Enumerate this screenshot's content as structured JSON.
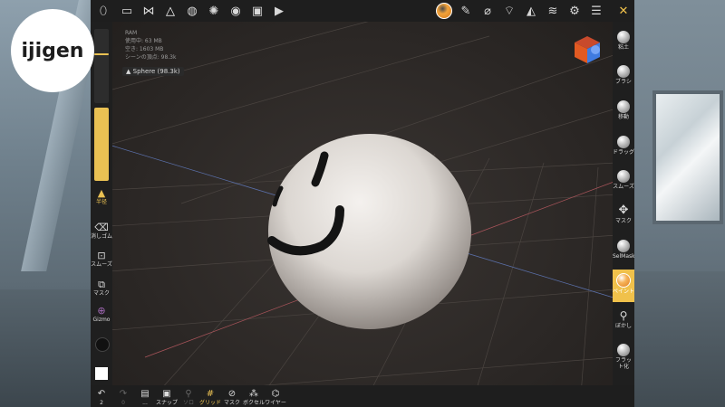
{
  "logo": {
    "text": "ijigen"
  },
  "stats": {
    "ram": "RAM",
    "used": "使用中: 63 MB",
    "free": "空き: 1603 MB",
    "scene": "シーンの頂点: 98.3k"
  },
  "object": {
    "label": "Sphere (98.3k)"
  },
  "top_toolbar": {
    "icons": [
      "eye-dropper-icon",
      "folder-icon",
      "scene-graph-icon",
      "topology-icon",
      "globe-icon",
      "sun-icon",
      "render-settings-icon",
      "image-icon",
      "video-icon",
      "paint-ball-icon",
      "pencil-icon",
      "eyedropper-icon",
      "paint-bucket-icon",
      "triangle-icon",
      "layers-icon",
      "gear-icon",
      "sliders-icon",
      "tools-icon"
    ]
  },
  "left_toolbar": {
    "radius_label": "半径",
    "tools": [
      {
        "name": "eraser",
        "label": "消しゴム"
      },
      {
        "name": "smooth",
        "label": "スムーズ"
      },
      {
        "name": "mask",
        "label": "マスク"
      },
      {
        "name": "gizmo",
        "label": "Gizmo"
      }
    ],
    "radius_value": 0.66,
    "intensity_value": 0.26,
    "primary_color": "#111111",
    "secondary_color": "#ffffff"
  },
  "right_toolbar": {
    "tools": [
      {
        "label": "粘土",
        "active": false
      },
      {
        "label": "ブラシ",
        "active": false
      },
      {
        "label": "移動",
        "active": false
      },
      {
        "label": "ドラッグ",
        "active": false
      },
      {
        "label": "スムーズ",
        "active": false
      },
      {
        "label": "マスク",
        "active": false
      },
      {
        "label": "SelMask",
        "active": false
      },
      {
        "label": "ペイント",
        "active": true
      },
      {
        "label": "ぼかし",
        "active": false
      },
      {
        "label": "フラット化",
        "active": false
      }
    ]
  },
  "bottom_toolbar": {
    "tools": [
      {
        "name": "undo",
        "label": "2"
      },
      {
        "name": "redo",
        "label": "0"
      },
      {
        "name": "bookmark",
        "label": "..."
      },
      {
        "name": "snap",
        "label": "スナップ"
      },
      {
        "name": "solo",
        "label": "ソロ"
      },
      {
        "name": "grid",
        "label": "グリッド"
      },
      {
        "name": "mask",
        "label": "マスク"
      },
      {
        "name": "voxel",
        "label": "ボクセル"
      },
      {
        "name": "wire",
        "label": "ワイヤー"
      }
    ]
  },
  "colors": {
    "accent": "#f0c14b",
    "toolbar": "#1e1e1e",
    "sphere": "#e6e2de"
  }
}
